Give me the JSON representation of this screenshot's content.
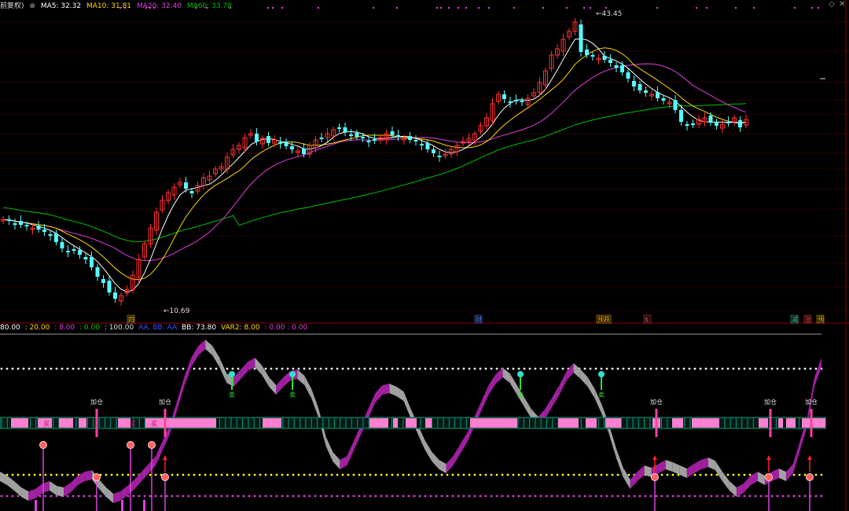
{
  "header": {
    "title_fragment": "前复权)",
    "ma5": "MA5: 32.32",
    "ma10": "MA10: 31.81",
    "ma20": "MA20: 32.40",
    "ma60": "MA60: 33.78"
  },
  "price_labels": {
    "high": "43.45",
    "low": "10.69"
  },
  "event_markers": [
    {
      "label": "财",
      "color": "#4a7dff"
    },
    {
      "label": "预跌",
      "color": "#ffb000"
    },
    {
      "label": "$",
      "color": "#ff4040"
    },
    {
      "label": "减",
      "color": "#2fd0a0"
    },
    {
      "label": "涨",
      "color": "#ff3030"
    },
    {
      "label": "预",
      "color": "#ffb000"
    },
    {
      "label": "四",
      "color": "#ffb000"
    }
  ],
  "indicator_header": {
    "v1": "80.00",
    "v2": ": 20.00",
    "v3": ": 8.00",
    "v4": ": 0.00",
    "v5": ": 100.00",
    "v6": "AA, BB: AA",
    "bb": "BB: 73.80",
    "var2": "VAR2: 8.00",
    "tail": ": 0.00 : 0.00"
  },
  "signals": {
    "add": "加仓",
    "sell": "卖",
    "buy": "买"
  },
  "colors": {
    "ma5": "#ffffff",
    "ma10": "#ffd700",
    "ma20": "#e040e0",
    "ma60": "#00c000",
    "up": "#ff3030",
    "down": "#54ffff",
    "purple": "#a020a0",
    "gray": "#a0a0a0",
    "pink": "#ff80d0"
  },
  "icons": [
    "diamond-icon",
    "close-icon"
  ]
}
